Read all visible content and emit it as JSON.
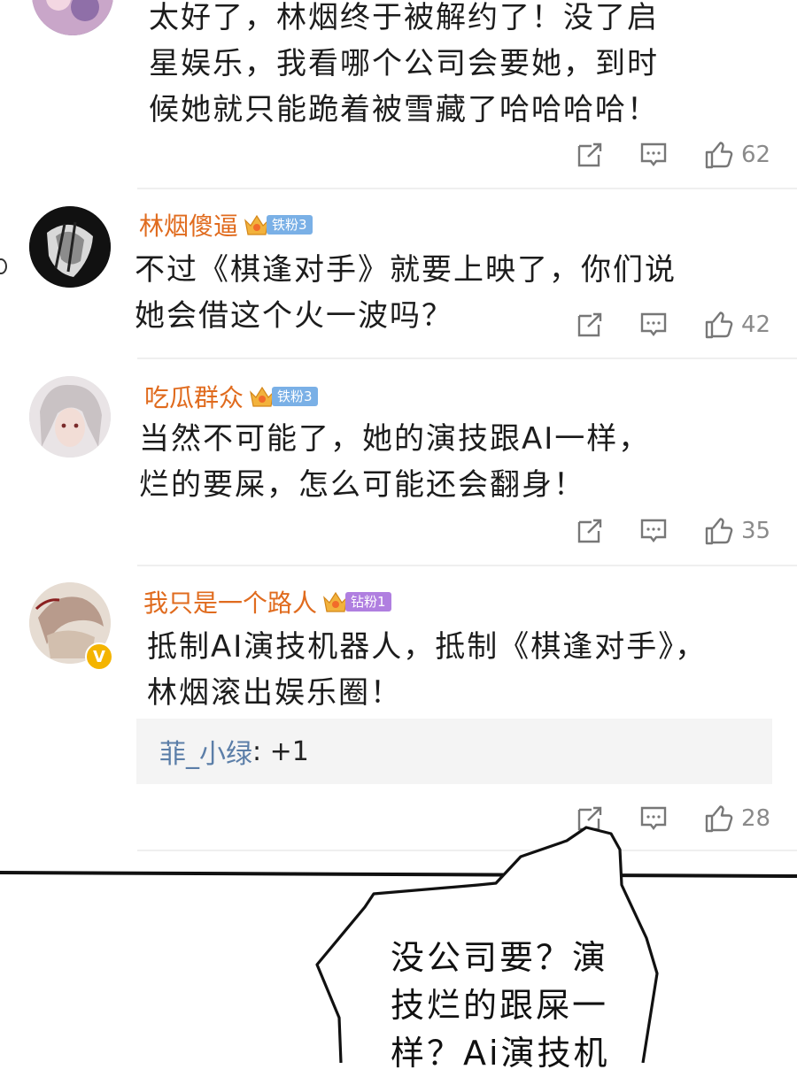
{
  "comments": [
    {
      "text_lines": [
        "太好了，林烟终于被解约了！没了启",
        "星娱乐，我看哪个公司会要她，到时",
        "候她就只能跪着被雪藏了哈哈哈哈！"
      ],
      "likes": "62"
    },
    {
      "username": "林烟傻逼",
      "badge": "铁粉3",
      "text_lines": [
        "不过《棋逢对手》就要上映了，你们说",
        "她会借这个火一波吗？"
      ],
      "likes": "42"
    },
    {
      "username": "吃瓜群众",
      "badge": "铁粉3",
      "text_lines": [
        "当然不可能了，她的演技跟AI一样，",
        "烂的要屎，怎么可能还会翻身！"
      ],
      "likes": "35"
    },
    {
      "username": "我只是一个路人",
      "badge": "钻粉1",
      "verified_mark": "V",
      "text_lines": [
        "抵制AI演技机器人，抵制《棋逢对手》，",
        "林烟滚出娱乐圈！"
      ],
      "reply": {
        "name": "菲_小绿",
        "text": ": +1"
      },
      "likes": "28"
    }
  ],
  "speech_bubble": {
    "lines": [
      "没公司要？演",
      "技烂的跟屎一",
      "样？Ai演技机"
    ]
  },
  "icons": {
    "share": "share-icon",
    "comment": "comment-icon",
    "like": "thumbs-up-icon",
    "badge": "crown-icon"
  },
  "colors": {
    "username": "#e06b1e",
    "reply_name": "#5b7ea8",
    "badge_iron": "#7ab0e6",
    "badge_diamond": "#b07fe0",
    "action_gray": "#8a8a8a"
  }
}
